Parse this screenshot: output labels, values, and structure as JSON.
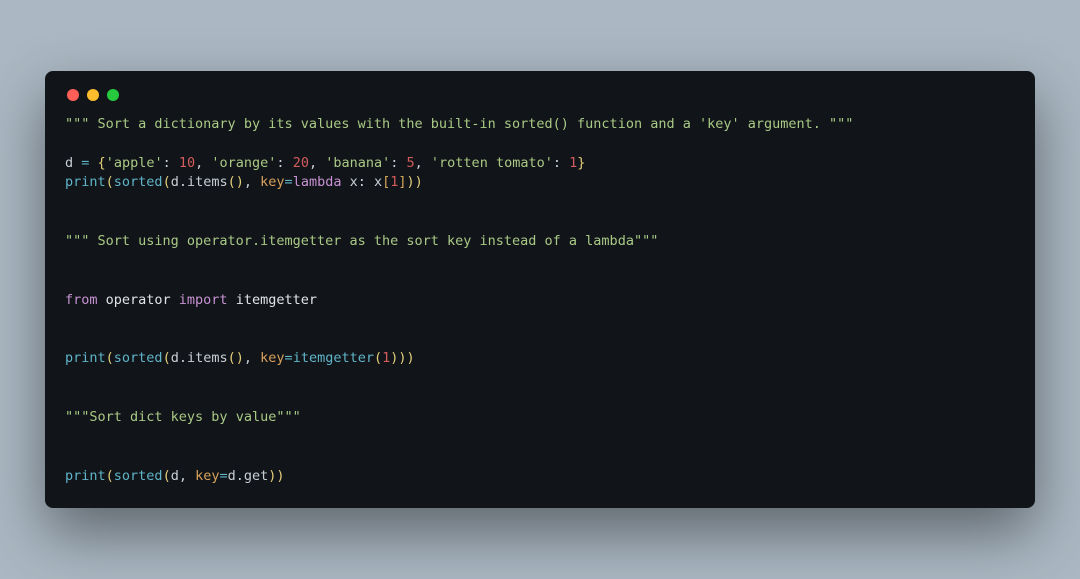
{
  "code": {
    "comment1_open": "\"\"\" ",
    "comment1_body": "Sort a dictionary by its values with the built-in sorted() function and a 'key' argument.",
    "comment1_close": " \"\"\"",
    "dline_prefix": "d ",
    "dline_eq": "=",
    "dline_sp": " ",
    "brace_open": "{",
    "k1": "'apple'",
    "colon": ": ",
    "v1": "10",
    "comma": ", ",
    "k2": "'orange'",
    "v2": "20",
    "k3": "'banana'",
    "v3": "5",
    "k4": "'rotten tomato'",
    "v4": "1",
    "brace_close": "}",
    "print": "print",
    "sorted": "sorted",
    "d_items": "d.items",
    "key_eq": "key",
    "lambda_kw": "lambda",
    "lambda_rest": " x: x",
    "idx_open": "[",
    "idx_1": "1",
    "idx_close": "]",
    "lp": "(",
    "rp": ")",
    "comma2": ", ",
    "eq": "=",
    "comment2_open": "\"\"\" ",
    "comment2_body": "Sort using operator.itemgetter as the sort key instead of a lambda",
    "comment2_close": "\"\"\"",
    "from_kw": "from",
    "operator_mod": " operator ",
    "import_kw": "import",
    "itemgetter_name": " itemgetter",
    "itemgetter_call": "itemgetter",
    "one": "1",
    "comment3_open": "\"\"\"",
    "comment3_body": "Sort dict keys by value",
    "comment3_close": "\"\"\"",
    "d_ident": "d",
    "d_get": "d.get"
  }
}
